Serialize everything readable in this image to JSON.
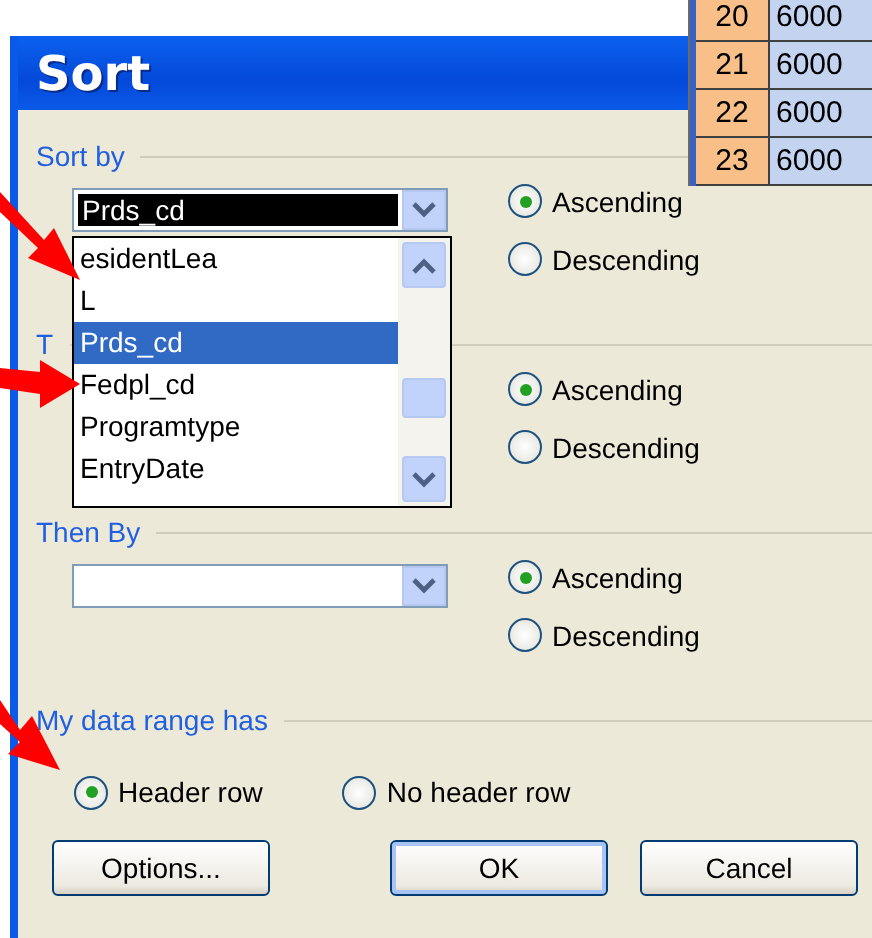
{
  "window": {
    "title": "Sort"
  },
  "sheet_rows": [
    {
      "row": "20",
      "value": "6000"
    },
    {
      "row": "21",
      "value": "6000"
    },
    {
      "row": "22",
      "value": "6000"
    },
    {
      "row": "23",
      "value": "6000"
    }
  ],
  "sections": [
    {
      "label": "Sort by",
      "combo_value": "Prds_cd",
      "radios": [
        {
          "label": "Ascending",
          "selected": true
        },
        {
          "label": "Descending",
          "selected": false
        }
      ]
    },
    {
      "label": "T",
      "radios": [
        {
          "label": "Ascending",
          "selected": true
        },
        {
          "label": "Descending",
          "selected": false
        }
      ]
    },
    {
      "label": "Then By",
      "radios": [
        {
          "label": "Ascending",
          "selected": true
        },
        {
          "label": "Descending",
          "selected": false
        }
      ]
    }
  ],
  "dropdown_list": {
    "items": [
      {
        "label": "esidentLea",
        "selected": false
      },
      {
        "label": "L",
        "selected": false
      },
      {
        "label": "Prds_cd",
        "selected": true
      },
      {
        "label": "Fedpl_cd",
        "selected": false
      },
      {
        "label": "Programtype",
        "selected": false
      },
      {
        "label": "EntryDate",
        "selected": false
      }
    ]
  },
  "header_section": {
    "label": "My data range has",
    "radios": [
      {
        "label": "Header row",
        "selected": true
      },
      {
        "label": "No header row",
        "selected": false
      }
    ]
  },
  "buttons": [
    {
      "label": "Options...",
      "kind": "default"
    },
    {
      "label": "OK",
      "kind": "primary"
    },
    {
      "label": "Cancel",
      "kind": "default"
    }
  ]
}
